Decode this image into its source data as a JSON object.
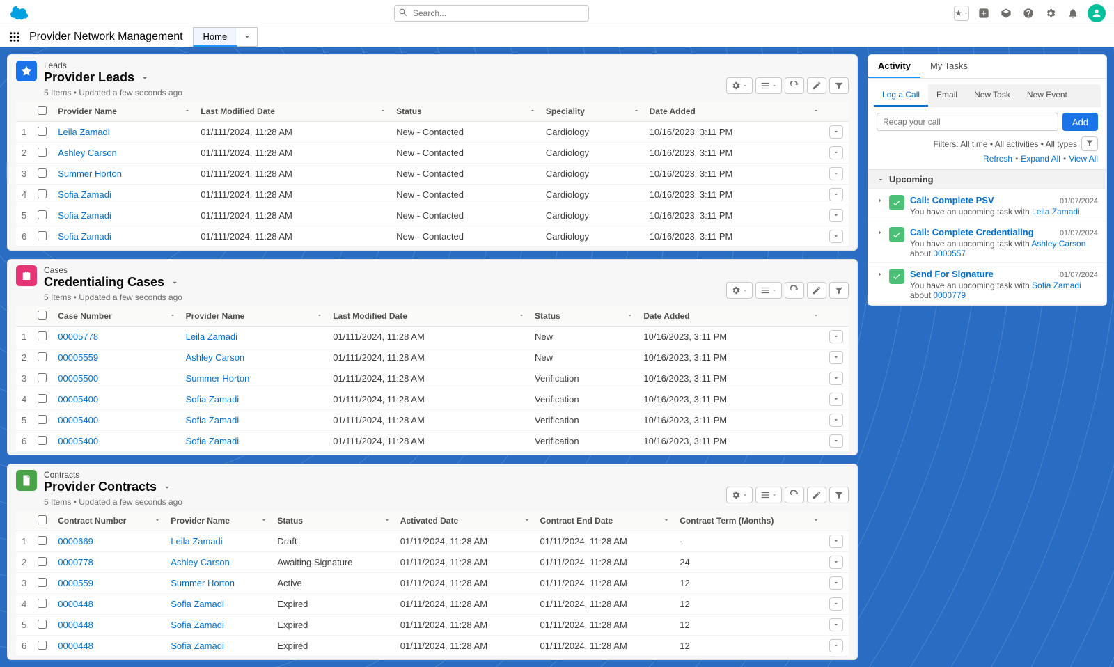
{
  "header": {
    "search_placeholder": "Search..."
  },
  "nav": {
    "app_name": "Provider Network Management",
    "active_tab": "Home"
  },
  "panels": [
    {
      "id": "leads",
      "icon_color": "#1a73e8",
      "subtitle": "Leads",
      "title": "Provider Leads",
      "meta": "5 Items • Updated a few seconds ago",
      "columns": [
        "Provider Name",
        "Last Modified Date",
        "Status",
        "Speciality",
        "Date Added"
      ],
      "rows": [
        {
          "c": [
            "Leila Zamadi",
            "01/111/2024, 11:28 AM",
            "New - Contacted",
            "Cardiology",
            "10/16/2023, 3:11 PM"
          ],
          "link_cols": [
            0
          ]
        },
        {
          "c": [
            "Ashley Carson",
            "01/111/2024, 11:28 AM",
            "New - Contacted",
            "Cardiology",
            "10/16/2023, 3:11 PM"
          ],
          "link_cols": [
            0
          ]
        },
        {
          "c": [
            "Summer Horton",
            "01/111/2024, 11:28 AM",
            "New - Contacted",
            "Cardiology",
            "10/16/2023, 3:11 PM"
          ],
          "link_cols": [
            0
          ]
        },
        {
          "c": [
            "Sofia Zamadi",
            "01/111/2024, 11:28 AM",
            "New - Contacted",
            "Cardiology",
            "10/16/2023, 3:11 PM"
          ],
          "link_cols": [
            0
          ]
        },
        {
          "c": [
            "Sofia Zamadi",
            "01/111/2024, 11:28 AM",
            "New - Contacted",
            "Cardiology",
            "10/16/2023, 3:11 PM"
          ],
          "link_cols": [
            0
          ]
        },
        {
          "c": [
            "Sofia Zamadi",
            "01/111/2024, 11:28 AM",
            "New - Contacted",
            "Cardiology",
            "10/16/2023, 3:11 PM"
          ],
          "link_cols": [
            0
          ]
        }
      ]
    },
    {
      "id": "cases",
      "icon_color": "#e63576",
      "subtitle": "Cases",
      "title": "Credentialing Cases",
      "meta": "5 Items • Updated a few seconds ago",
      "columns": [
        "Case Number",
        "Provider Name",
        "Last Modified Date",
        "Status",
        "Date Added"
      ],
      "rows": [
        {
          "c": [
            "00005778",
            "Leila Zamadi",
            "01/111/2024, 11:28 AM",
            "New",
            "10/16/2023, 3:11 PM"
          ],
          "link_cols": [
            0,
            1
          ]
        },
        {
          "c": [
            "00005559",
            "Ashley Carson",
            "01/111/2024, 11:28 AM",
            "New",
            "10/16/2023, 3:11 PM"
          ],
          "link_cols": [
            0,
            1
          ]
        },
        {
          "c": [
            "00005500",
            "Summer Horton",
            "01/111/2024, 11:28 AM",
            "Verification",
            "10/16/2023, 3:11 PM"
          ],
          "link_cols": [
            0,
            1
          ]
        },
        {
          "c": [
            "00005400",
            "Sofia Zamadi",
            "01/111/2024, 11:28 AM",
            "Verification",
            "10/16/2023, 3:11 PM"
          ],
          "link_cols": [
            0,
            1
          ]
        },
        {
          "c": [
            "00005400",
            "Sofia Zamadi",
            "01/111/2024, 11:28 AM",
            "Verification",
            "10/16/2023, 3:11 PM"
          ],
          "link_cols": [
            0,
            1
          ]
        },
        {
          "c": [
            "00005400",
            "Sofia Zamadi",
            "01/111/2024, 11:28 AM",
            "Verification",
            "10/16/2023, 3:11 PM"
          ],
          "link_cols": [
            0,
            1
          ]
        }
      ]
    },
    {
      "id": "contracts",
      "icon_color": "#48a446",
      "subtitle": "Contracts",
      "title": "Provider Contracts",
      "meta": "5 Items • Updated a few seconds ago",
      "columns": [
        "Contract Number",
        "Provider Name",
        "Status",
        "Activated Date",
        "Contract End Date",
        "Contract Term (Months)"
      ],
      "rows": [
        {
          "c": [
            "0000669",
            "Leila Zamadi",
            "Draft",
            "01/11/2024, 11:28 AM",
            "01/11/2024, 11:28 AM",
            "-"
          ],
          "link_cols": [
            0,
            1
          ]
        },
        {
          "c": [
            "0000778",
            "Ashley Carson",
            "Awaiting Signature",
            "01/11/2024, 11:28 AM",
            "01/11/2024, 11:28 AM",
            "24"
          ],
          "link_cols": [
            0,
            1
          ]
        },
        {
          "c": [
            "0000559",
            "Summer Horton",
            "Active",
            "01/11/2024, 11:28 AM",
            "01/11/2024, 11:28 AM",
            "12"
          ],
          "link_cols": [
            0,
            1
          ]
        },
        {
          "c": [
            "0000448",
            "Sofia Zamadi",
            "Expired",
            "01/11/2024, 11:28 AM",
            "01/11/2024, 11:28 AM",
            "12"
          ],
          "link_cols": [
            0,
            1
          ]
        },
        {
          "c": [
            "0000448",
            "Sofia Zamadi",
            "Expired",
            "01/11/2024, 11:28 AM",
            "01/11/2024, 11:28 AM",
            "12"
          ],
          "link_cols": [
            0,
            1
          ]
        },
        {
          "c": [
            "0000448",
            "Sofia Zamadi",
            "Expired",
            "01/11/2024, 11:28 AM",
            "01/11/2024, 11:28 AM",
            "12"
          ],
          "link_cols": [
            0,
            1
          ]
        }
      ]
    }
  ],
  "sidebar": {
    "tabs": [
      "Activity",
      "My Tasks"
    ],
    "action_tabs": [
      "Log a Call",
      "Email",
      "New Task",
      "New Event"
    ],
    "recap_placeholder": "Recap your call",
    "add_label": "Add",
    "filters_text": "Filters: All time • All activities • All types",
    "refresh_links": [
      "Refresh",
      "Expand All",
      "View All"
    ],
    "upcoming_label": "Upcoming",
    "items": [
      {
        "title": "Call: Complete PSV",
        "date": "01/07/2024",
        "desc_prefix": "You have an upcoming task with",
        "link1": "Leila Zamadi"
      },
      {
        "title": "Call: Complete Credentialing",
        "date": "01/07/2024",
        "desc_prefix": "You have an upcoming task with",
        "link1": "Ashley Carson",
        "about": " about ",
        "link2": "0000557"
      },
      {
        "title": "Send For Signature",
        "date": "01/07/2024",
        "desc_prefix": "You have an upcoming task with",
        "link1": "Sofia Zamadi",
        "about": " about ",
        "link2": "0000779"
      }
    ]
  }
}
